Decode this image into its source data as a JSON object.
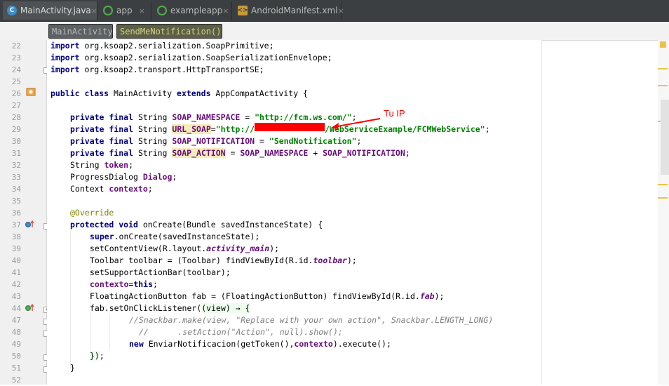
{
  "tabs": [
    {
      "label": "MainActivity.java",
      "icon": "java-class-icon",
      "active": true
    },
    {
      "label": "app",
      "icon": "gradle-module-icon",
      "active": false
    },
    {
      "label": "exampleapp",
      "icon": "gradle-module-icon",
      "active": false
    },
    {
      "label": "AndroidManifest.xml",
      "icon": "xml-file-icon",
      "active": false
    }
  ],
  "tab_close": "×",
  "breadcrumbs": [
    "MainActivity",
    "SendMeNotification()"
  ],
  "line_numbers": [
    "22",
    "23",
    "24",
    "25",
    "26",
    "27",
    "28",
    "29",
    "30",
    "31",
    "32",
    "33",
    "34",
    "35",
    "36",
    "37",
    "38",
    "39",
    "40",
    "41",
    "42",
    "43",
    "44",
    "47",
    "48",
    "49",
    "50",
    "51",
    "52",
    "53"
  ],
  "code": {
    "l22": {
      "kw": "import",
      "rest": " org.ksoap2.serialization.SoapPrimitive;"
    },
    "l23": {
      "kw": "import",
      "rest": " org.ksoap2.serialization.SoapSerializationEnvelope;"
    },
    "l24": {
      "kw": "import",
      "rest": " org.ksoap2.transport.HttpTransportSE;"
    },
    "l26": {
      "kw1": "public class",
      "name": " MainActivity ",
      "kw2": "extends",
      "rest": " AppCompatActivity {"
    },
    "l28": {
      "kw": "private final",
      "type": " String ",
      "var": "SOAP_NAMESPACE",
      "eq": " = ",
      "str": "\"http://fcm.ws.com/\"",
      "end": ";"
    },
    "l29": {
      "kw": "private final",
      "type": " String ",
      "var": "URL_SOAP",
      "eq": "=",
      "str1": "\"http://",
      "str2": "/WebServiceExample/FCMWebService\"",
      "end": ";"
    },
    "l30": {
      "kw": "private final",
      "type": " String ",
      "var": "SOAP_NOTIFICATION",
      "eq": " = ",
      "str": "\"SendNotification\"",
      "end": ";"
    },
    "l31": {
      "kw": "private final",
      "type": " String ",
      "var": "SOAP_ACTION",
      "eq": " = ",
      "v1": "SOAP_NAMESPACE",
      "plus": " + ",
      "v2": "SOAP_NOTIFICATION",
      "end": ";"
    },
    "l32": {
      "type": "String ",
      "var": "token",
      "end": ";"
    },
    "l33": {
      "type": "ProgressDialog ",
      "var": "Dialog",
      "end": ";"
    },
    "l34": {
      "type": "Context ",
      "var": "contexto",
      "end": ";"
    },
    "l36": {
      "ann": "@Override"
    },
    "l37": {
      "kw": "protected void",
      "rest": " onCreate(Bundle savedInstanceState) {"
    },
    "l38": {
      "kw": "super",
      "rest": ".onCreate(savedInstanceState);"
    },
    "l39": {
      "pre": "setContentView(R.layout.",
      "fld": "activity_main",
      "post": ");"
    },
    "l40": {
      "pre": "Toolbar toolbar = (Toolbar) findViewById(R.id.",
      "fld": "toolbar",
      "post": ");"
    },
    "l41": {
      "text": "setSupportActionBar(toolbar);"
    },
    "l42": {
      "fld": "contexto",
      "eq": "=",
      "kw": "this",
      "end": ";"
    },
    "l43": {
      "pre": "FloatingActionButton fab = (FloatingActionButton) findViewById(R.id.",
      "fld": "fab",
      "post": ");"
    },
    "l44": {
      "pre": "fab.setOnClickListener(",
      "lam": "(view) → {"
    },
    "l47": {
      "cmt": "//Snackbar.make(view, \"Replace with your own action\", Snackbar.LENGTH_LONG)"
    },
    "l48": {
      "cmt": "//      .setAction(\"Action\", null).show();"
    },
    "l49": {
      "kw": "new",
      "pre": " EnviarNotificacion(getToken(),",
      "fld": "contexto",
      "post": ").execute();"
    },
    "l50": {
      "lam": "})",
      "end": ";"
    },
    "l52": {
      "text": "}"
    }
  },
  "annotation_label": "Tu IP",
  "colors": {
    "annotation": "#ff0000",
    "keyword": "#000080",
    "string": "#008000",
    "field": "#660e7a"
  }
}
